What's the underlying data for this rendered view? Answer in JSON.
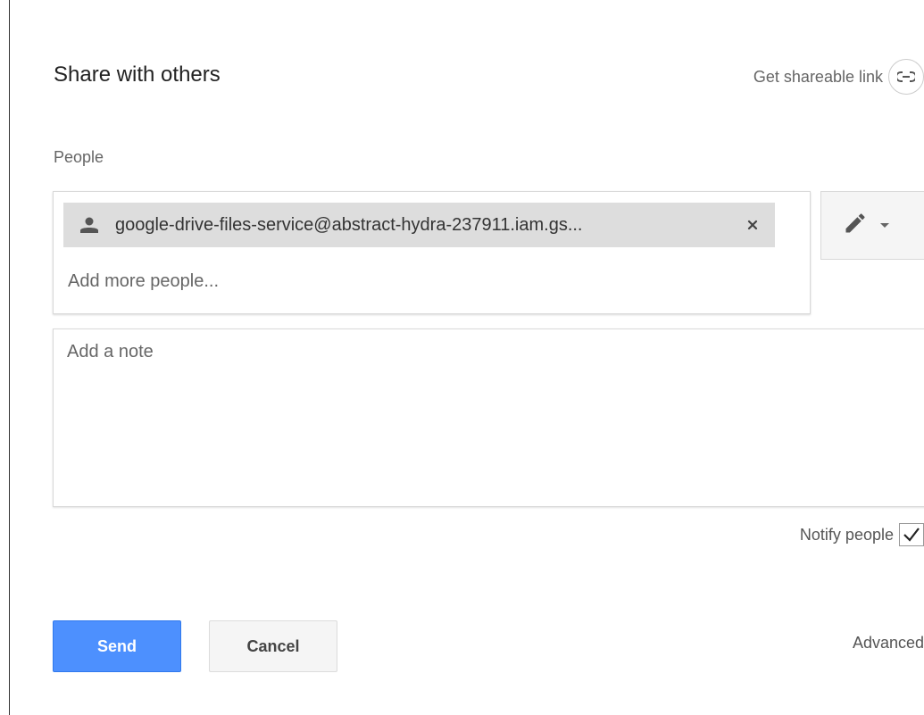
{
  "dialog": {
    "title": "Share with others"
  },
  "share_link": {
    "label": "Get shareable link",
    "icon": "link-icon"
  },
  "people": {
    "label": "People",
    "chips": [
      {
        "email": "google-drive-files-service@abstract-hydra-237911.iam.gs...",
        "icon": "person-icon",
        "remove_icon": "close-icon"
      }
    ],
    "add_placeholder": "Add more people...",
    "permission_icon": "pencil-icon",
    "permission_caret_icon": "caret-down-icon"
  },
  "note": {
    "placeholder": "Add a note"
  },
  "notify": {
    "label": "Notify people",
    "checked": true
  },
  "actions": {
    "send_label": "Send",
    "cancel_label": "Cancel",
    "advanced_label": "Advanced"
  },
  "colors": {
    "primary": "#4d90fe",
    "chip_background": "#dddddd"
  }
}
